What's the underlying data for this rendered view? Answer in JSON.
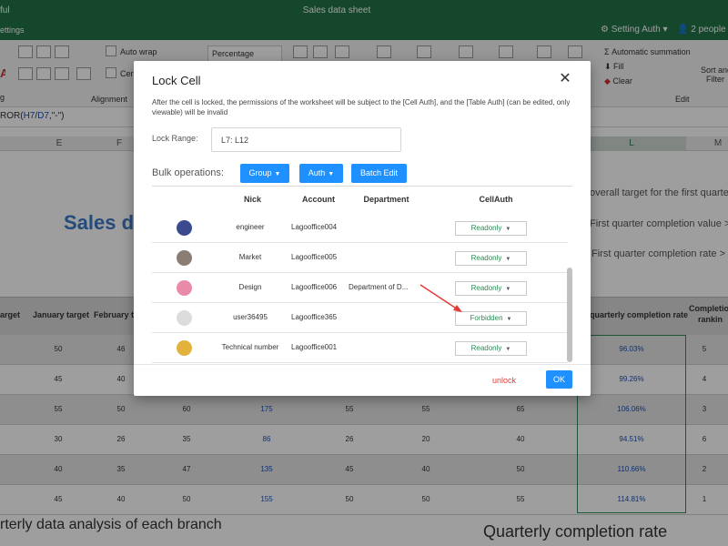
{
  "app": {
    "title": "Sales data sheet",
    "app_name_fragment": "ful",
    "settings_fragment": "ettings",
    "setting_auth": "Setting Auth",
    "people_online": "2 people an"
  },
  "ribbon": {
    "auto_wrap": "Auto wrap",
    "center_fragment": "Cen",
    "number_format": "Percentage",
    "alignment_group": "Alignment",
    "auto_summation": "Automatic summation",
    "fill": "Fill",
    "clear": "Clear",
    "sort_and": "Sort and",
    "filter": "Filter",
    "edit_group": "Edit",
    "g_fragment": "g"
  },
  "formula_bar": {
    "fn_prefix": "ROR(",
    "ref1": "H7",
    "sep": "/",
    "ref2": "D7",
    "suffix": ",\"-\")"
  },
  "columns": {
    "e": "E",
    "f": "F",
    "l": "L",
    "m": "M"
  },
  "sheet": {
    "big_title": "Sales d",
    "overall_target": "overall target for the first quarter",
    "completion_value": "First quarter completion value >",
    "completion_rate": "First quarter completion rate >",
    "headers": {
      "target": "arget",
      "january": "January target",
      "february": "February ta",
      "quarterly_rate": "quarterly completion rate",
      "ranking_1": "Completio",
      "ranking_2": "rankin"
    },
    "rows": [
      {
        "jan": "50",
        "feb": "46",
        "mar": "",
        "blue": "",
        "c1": "",
        "c2": "",
        "c3": "",
        "rate": "96.03%",
        "rank": "5"
      },
      {
        "jan": "45",
        "feb": "40",
        "mar": "",
        "blue": "",
        "c1": "",
        "c2": "",
        "c3": "",
        "rate": "99.26%",
        "rank": "4"
      },
      {
        "jan": "55",
        "feb": "50",
        "mar": "60",
        "blue": "175",
        "c1": "55",
        "c2": "55",
        "c3": "65",
        "rate": "106.06%",
        "rank": "3"
      },
      {
        "jan": "30",
        "feb": "26",
        "mar": "35",
        "blue": "86",
        "c1": "26",
        "c2": "20",
        "c3": "40",
        "rate": "94.51%",
        "rank": "6"
      },
      {
        "jan": "40",
        "feb": "35",
        "mar": "47",
        "blue": "135",
        "c1": "45",
        "c2": "40",
        "c3": "50",
        "rate": "110.66%",
        "rank": "2"
      },
      {
        "jan": "45",
        "feb": "40",
        "mar": "50",
        "blue": "155",
        "c1": "50",
        "c2": "50",
        "c3": "55",
        "rate": "114.81%",
        "rank": "1"
      }
    ],
    "footer_left": "rterly data analysis of each branch",
    "footer_right": "Quarterly completion rate"
  },
  "dialog": {
    "title": "Lock Cell",
    "close_glyph": "✕",
    "note": "After the cell is locked, the permissions of the worksheet will be subject to the [Cell Auth], and the [Table Auth] (can be edited, only viewable) will be invalid",
    "lock_range_label": "Lock Range:",
    "lock_range_value": "L7: L12",
    "bulk_label": "Bulk operations:",
    "group_btn": "Group",
    "auth_btn": "Auth",
    "batch_edit_btn": "Batch Edit",
    "caret": "▼",
    "columns": {
      "nick": "Nick",
      "account": "Account",
      "department": "Department",
      "cellauth": "CellAuth"
    },
    "users": [
      {
        "nick": "engineer",
        "account": "Lagooffice004",
        "department": "",
        "auth": "Readonly",
        "avatar": "avatar-engineer-icon",
        "avatar_color": "#3b4a8f"
      },
      {
        "nick": "Market",
        "account": "Lagooffice005",
        "department": "",
        "auth": "Readonly",
        "avatar": "avatar-market-icon",
        "avatar_color": "#8a7d74"
      },
      {
        "nick": "Design",
        "account": "Lagooffice006",
        "department": "Department of D...",
        "auth": "Readonly",
        "avatar": "avatar-design-icon",
        "avatar_color": "#e88aa8"
      },
      {
        "nick": "user36495",
        "account": "Lagooffice365",
        "department": "",
        "auth": "Forbidden",
        "avatar": "avatar-user-icon",
        "avatar_color": "#dcdcdc"
      },
      {
        "nick": "Technical number",
        "account": "Lagooffice001",
        "department": "",
        "auth": "Readonly",
        "avatar": "avatar-technical-icon",
        "avatar_color": "#e3b23c"
      }
    ],
    "unlock_btn": "unlock",
    "ok_btn": "OK"
  },
  "colors": {
    "brand_green": "#217346",
    "accent_blue": "#1e90ff",
    "danger_red": "#e53935",
    "auth_green": "#2e8b57"
  }
}
